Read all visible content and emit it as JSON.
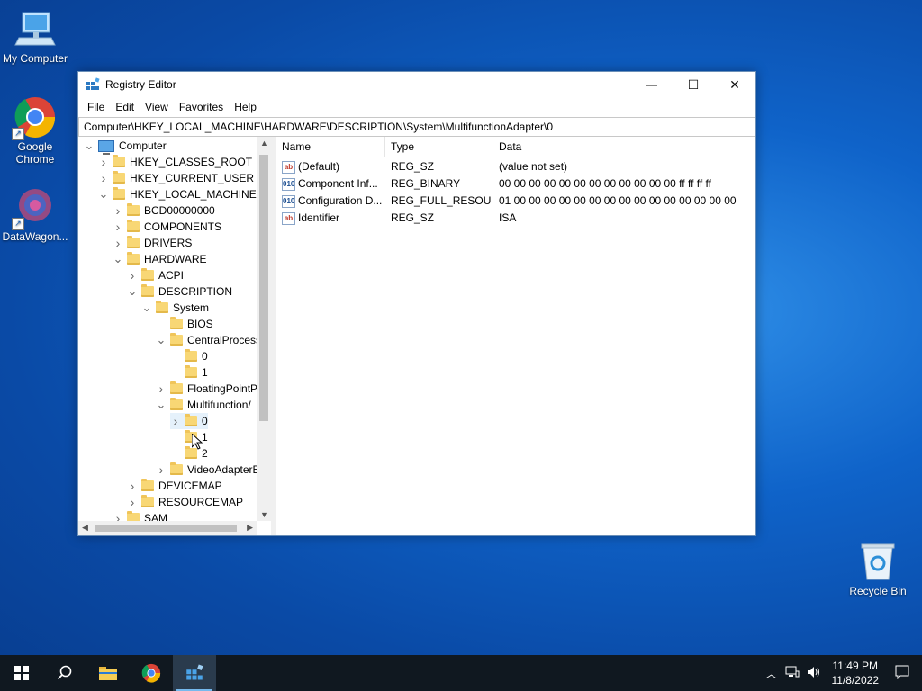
{
  "desktop": {
    "icons": [
      {
        "label": "My Computer"
      },
      {
        "label": "Google Chrome"
      },
      {
        "label": "DataWagon..."
      },
      {
        "label": "Recycle Bin"
      }
    ]
  },
  "window": {
    "title": "Registry Editor",
    "controls": {
      "minimize": "—",
      "maximize": "☐",
      "close": "✕"
    },
    "menu": [
      "File",
      "Edit",
      "View",
      "Favorites",
      "Help"
    ],
    "address": "Computer\\HKEY_LOCAL_MACHINE\\HARDWARE\\DESCRIPTION\\System\\MultifunctionAdapter\\0"
  },
  "tree": [
    {
      "label": "Computer",
      "level": 0,
      "expanded": true,
      "icon": "computer-icon"
    },
    {
      "label": "HKEY_CLASSES_ROOT",
      "level": 1,
      "expanded": false
    },
    {
      "label": "HKEY_CURRENT_USER",
      "level": 1,
      "expanded": false
    },
    {
      "label": "HKEY_LOCAL_MACHINE",
      "level": 1,
      "expanded": true
    },
    {
      "label": "BCD00000000",
      "level": 2,
      "expanded": false
    },
    {
      "label": "COMPONENTS",
      "level": 2,
      "expanded": false
    },
    {
      "label": "DRIVERS",
      "level": 2,
      "expanded": false
    },
    {
      "label": "HARDWARE",
      "level": 2,
      "expanded": true
    },
    {
      "label": "ACPI",
      "level": 3,
      "expanded": false
    },
    {
      "label": "DESCRIPTION",
      "level": 3,
      "expanded": true
    },
    {
      "label": "System",
      "level": 4,
      "expanded": true
    },
    {
      "label": "BIOS",
      "level": 5,
      "expanded": null
    },
    {
      "label": "CentralProcess",
      "level": 5,
      "expanded": true
    },
    {
      "label": "0",
      "level": 6,
      "expanded": null
    },
    {
      "label": "1",
      "level": 6,
      "expanded": null
    },
    {
      "label": "FloatingPointP",
      "level": 5,
      "expanded": false
    },
    {
      "label": "Multifunction/",
      "level": 5,
      "expanded": true
    },
    {
      "label": "0",
      "level": 6,
      "expanded": false,
      "selected": true
    },
    {
      "label": "1",
      "level": 6,
      "expanded": null
    },
    {
      "label": "2",
      "level": 6,
      "expanded": null
    },
    {
      "label": "VideoAdapterB",
      "level": 5,
      "expanded": false
    },
    {
      "label": "DEVICEMAP",
      "level": 3,
      "expanded": false
    },
    {
      "label": "RESOURCEMAP",
      "level": 3,
      "expanded": false
    },
    {
      "label": "SAM",
      "level": 2,
      "expanded": false
    }
  ],
  "list": {
    "columns": [
      "Name",
      "Type",
      "Data"
    ],
    "rows": [
      {
        "icon": "ab",
        "name": "(Default)",
        "type": "REG_SZ",
        "data": "(value not set)"
      },
      {
        "icon": "bin",
        "name": "Component Inf...",
        "type": "REG_BINARY",
        "data": "00 00 00 00 00 00 00 00 00 00 00 00 ff ff ff ff"
      },
      {
        "icon": "bin",
        "name": "Configuration D...",
        "type": "REG_FULL_RESOU...",
        "data": "01 00 00 00 00 00 00 00 00 00 00 00 00 00 00 00"
      },
      {
        "icon": "ab",
        "name": "Identifier",
        "type": "REG_SZ",
        "data": "ISA"
      }
    ]
  },
  "taskbar": {
    "time": "11:49 PM",
    "date": "11/8/2022"
  }
}
